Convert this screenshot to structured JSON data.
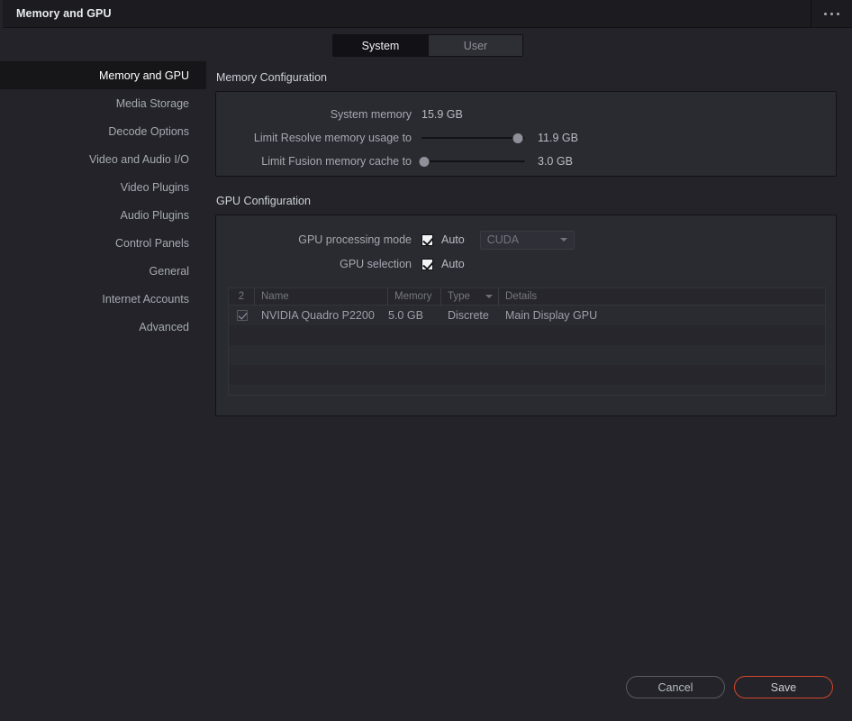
{
  "window": {
    "title": "Memory and GPU",
    "menu_icon": "ellipsis-icon"
  },
  "tabs": [
    {
      "label": "System",
      "active": true
    },
    {
      "label": "User",
      "active": false
    }
  ],
  "sidebar": {
    "items": [
      {
        "label": "Memory and GPU",
        "selected": true
      },
      {
        "label": "Media Storage",
        "selected": false
      },
      {
        "label": "Decode Options",
        "selected": false
      },
      {
        "label": "Video and Audio I/O",
        "selected": false
      },
      {
        "label": "Video Plugins",
        "selected": false
      },
      {
        "label": "Audio Plugins",
        "selected": false
      },
      {
        "label": "Control Panels",
        "selected": false
      },
      {
        "label": "General",
        "selected": false
      },
      {
        "label": "Internet Accounts",
        "selected": false
      },
      {
        "label": "Advanced",
        "selected": false
      }
    ]
  },
  "memory_configuration": {
    "title": "Memory Configuration",
    "system_memory": {
      "label": "System memory",
      "value": "15.9 GB"
    },
    "resolve_limit": {
      "label": "Limit Resolve memory usage to",
      "value": "11.9 GB",
      "slider_percent": 93
    },
    "fusion_limit": {
      "label": "Limit Fusion memory cache to",
      "value": "3.0 GB",
      "slider_percent": 3
    }
  },
  "gpu_configuration": {
    "title": "GPU Configuration",
    "processing_mode": {
      "label": "GPU processing mode",
      "auto_label": "Auto",
      "auto_checked": true,
      "mode_value": "CUDA",
      "mode_enabled": false
    },
    "gpu_selection": {
      "label": "GPU selection",
      "auto_label": "Auto",
      "auto_checked": true
    },
    "table": {
      "columns": [
        "2",
        "Name",
        "Memory",
        "Type",
        "Details"
      ],
      "sorted_column": "Type",
      "rows": [
        {
          "selected": true,
          "name": "NVIDIA Quadro P2200",
          "memory": "5.0 GB",
          "type": "Discrete",
          "details": "Main Display GPU"
        }
      ]
    }
  },
  "footer": {
    "cancel_label": "Cancel",
    "save_label": "Save",
    "save_accent": "#d2472e"
  }
}
